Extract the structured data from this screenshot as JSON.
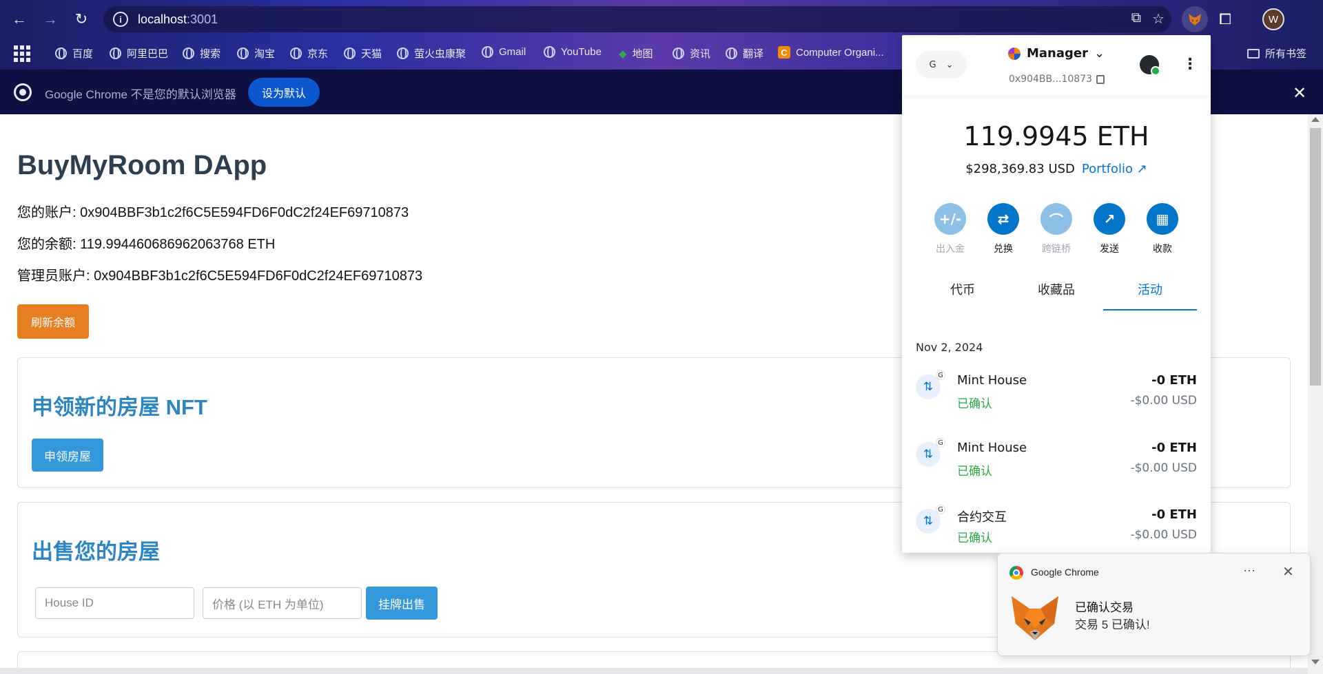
{
  "browser": {
    "url_host": "localhost",
    "url_port": ":3001",
    "profile_initial": "W",
    "bookmarks": [
      "百度",
      "阿里巴巴",
      "搜索",
      "淘宝",
      "京东",
      "天猫",
      "萤火虫康聚",
      "Gmail",
      "YouTube",
      "地图",
      "资讯",
      "翻译",
      "Computer Organi..."
    ],
    "bookmarks_folder": "所有书签",
    "infobar_text": "Google Chrome 不是您的默认浏览器",
    "infobar_button": "设为默认"
  },
  "page": {
    "title": "BuyMyRoom DApp",
    "account_line": "您的账户: 0x904BBF3b1c2f6C5E594FD6F0dC2f24EF69710873",
    "balance_line": "您的余额: 119.994460686962063768 ETH",
    "admin_line": "管理员账户: 0x904BBF3b1c2f6C5E594FD6F0dC2f24EF69710873",
    "refresh_button": "刷新余额",
    "claim_title": "申领新的房屋 NFT",
    "claim_button": "申领房屋",
    "sell_title": "出售您的房屋",
    "house_id_placeholder": "House ID",
    "price_placeholder": "价格 (以 ETH 为单位)",
    "list_button": "挂牌出售"
  },
  "metamask": {
    "network": "G",
    "account_name": "Manager",
    "address_short": "0x904BB...10873",
    "balance": "119.9945 ETH",
    "balance_usd": "$298,369.83 USD",
    "portfolio": "Portfolio",
    "actions": [
      {
        "label": "出入金",
        "icon": "+/-"
      },
      {
        "label": "兑换",
        "icon": "⇄"
      },
      {
        "label": "跨链桥",
        "icon": "⌒"
      },
      {
        "label": "发送",
        "icon": "↗"
      },
      {
        "label": "收款",
        "icon": "▦"
      }
    ],
    "tabs": [
      "代币",
      "收藏品",
      "活动"
    ],
    "date": "Nov 2, 2024",
    "transactions": [
      {
        "title": "Mint House",
        "status": "已确认",
        "amount": "-0 ETH",
        "usd": "-$0.00 USD"
      },
      {
        "title": "Mint House",
        "status": "已确认",
        "amount": "-0 ETH",
        "usd": "-$0.00 USD"
      },
      {
        "title": "合约交互",
        "status": "已确认",
        "amount": "-0 ETH",
        "usd": "-$0.00 USD"
      }
    ]
  },
  "notification": {
    "app": "Google Chrome",
    "title": "已确认交易",
    "body": "交易 5 已确认!"
  }
}
